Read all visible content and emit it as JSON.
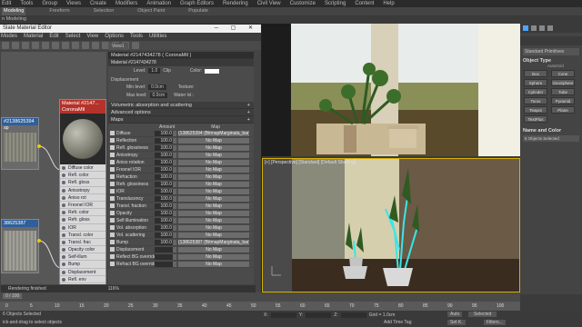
{
  "menubar": [
    "Edit",
    "Tools",
    "Group",
    "Views",
    "Create",
    "Modifiers",
    "Animation",
    "Graph Editors",
    "Rendering",
    "Civil View",
    "Customize",
    "Scripting",
    "Content",
    "Help"
  ],
  "ribbon": [
    "Modeling",
    "Freeform",
    "Selection",
    "Object Paint",
    "Populate"
  ],
  "modeling_label": "n Modeling",
  "slate": {
    "title": "Slate Material Editor",
    "menu": [
      "Modes",
      "Material",
      "Edit",
      "Select",
      "View",
      "Options",
      "Tools",
      "Utilities"
    ],
    "view_tab": "View1",
    "left_node_label": "#2138625394",
    "left_node_sub": "ap",
    "left_node2_label": "38625387",
    "node_title": "Material #2147...",
    "node_sub": "CoronaMtl",
    "slots": [
      "Diffuse color",
      "Refl. color",
      "Refl. gloss",
      "Anisotropy",
      "Aniso rot",
      "Fresnel IOR",
      "Refr. color",
      "Refr. gloss",
      "IOR",
      "Transl. color",
      "Transl. frac",
      "Opacity color",
      "Self-illum",
      "Bump",
      "Displacement",
      "Refl. env",
      "Refr. env",
      "Absorb. color",
      "Scatter color"
    ],
    "param_header": "Material #2147434278  ( CoronaMtl )",
    "param_name": "Material #2147434278",
    "level_label": "Level:",
    "level_val": "1.0",
    "clip_label": "Clip",
    "color_label": "Color:",
    "displacement_label": "Displacement",
    "min_level_label": "Min level:",
    "min_level_val": "0.0cm",
    "texture_label": "Texture:",
    "max_level_label": "Max level:",
    "max_level_val": "0.0cm",
    "water_level_label": "Water lvl.:",
    "sections": [
      "Volumetric absorption and scattering",
      "Advanced options",
      "Maps"
    ],
    "maps_cols": {
      "amount": "Amount",
      "map": "Map"
    },
    "maps": [
      {
        "name": "Diffuse",
        "amount": "100.0",
        "map": "(138625394 (BitmapMarginata_bar)"
      },
      {
        "name": "Reflection",
        "amount": "100.0",
        "map": "No Map"
      },
      {
        "name": "Refl. glossiness",
        "amount": "100.0",
        "map": "No Map"
      },
      {
        "name": "Anisotropy",
        "amount": "100.0",
        "map": "No Map"
      },
      {
        "name": "Aniso rotation",
        "amount": "100.0",
        "map": "No Map"
      },
      {
        "name": "Fresnel IOR",
        "amount": "100.0",
        "map": "No Map"
      },
      {
        "name": "Refraction",
        "amount": "100.0",
        "map": "No Map"
      },
      {
        "name": "Refr. glossiness",
        "amount": "100.0",
        "map": "No Map"
      },
      {
        "name": "IOR",
        "amount": "100.0",
        "map": "No Map"
      },
      {
        "name": "Translucency",
        "amount": "100.0",
        "map": "No Map"
      },
      {
        "name": "Transl. fraction",
        "amount": "100.0",
        "map": "No Map"
      },
      {
        "name": "Opacity",
        "amount": "100.0",
        "map": "No Map"
      },
      {
        "name": "Self illumination",
        "amount": "100.0",
        "map": "No Map"
      },
      {
        "name": "Vol. absorption",
        "amount": "100.0",
        "map": "No Map"
      },
      {
        "name": "Vol. scattering",
        "amount": "100.0",
        "map": "No Map"
      },
      {
        "name": "Bump",
        "amount": "100.0",
        "map": "(138625387 (BitmapMarginata_bar)"
      },
      {
        "name": "Displacement",
        "amount": "",
        "map": "No Map"
      },
      {
        "name": "Reflect BG override",
        "amount": "",
        "map": "No Map"
      },
      {
        "name": "Refract BG override",
        "amount": "",
        "map": "No Map"
      }
    ],
    "rendering_status": "Rendering finished",
    "zoom": "116%"
  },
  "viewport_label": "[+] [Perspective] [Standard] [Default Shading]",
  "cmd": {
    "dropdown": "Standard Primitives",
    "object_type": "Object Type",
    "autogrid": "AutoGrid",
    "buttons": [
      "Box",
      "Cone",
      "Sphere",
      "GeoSphere",
      "Cylinder",
      "Tube",
      "Torus",
      "Pyramid",
      "Teapot",
      "Plane",
      "TextPlus"
    ],
    "name_color": "Name and Color",
    "objects_selected": "6 Objects Selected"
  },
  "timeline": {
    "frame": "0 / 100",
    "ticks": [
      "0",
      "5",
      "10",
      "15",
      "20",
      "25",
      "30",
      "35",
      "40",
      "45",
      "50",
      "55",
      "60",
      "65",
      "70",
      "75",
      "80",
      "85",
      "90",
      "95",
      "100"
    ]
  },
  "status": {
    "selection": "6 Objects Selected",
    "hint": "ick-and-drag to select objects",
    "x_label": "X:",
    "y_label": "Y:",
    "z_label": "Z:",
    "grid": "Grid = 1.0cm",
    "add_time_tag": "Add Time Tag",
    "auto_key": "Auto",
    "selected": "Selected",
    "set_k": "Set K.",
    "filters": "Filters..."
  },
  "colors": {
    "accent": "#2f5f9a",
    "viewport_border": "#d8b000",
    "wire": "#39e6e6"
  }
}
